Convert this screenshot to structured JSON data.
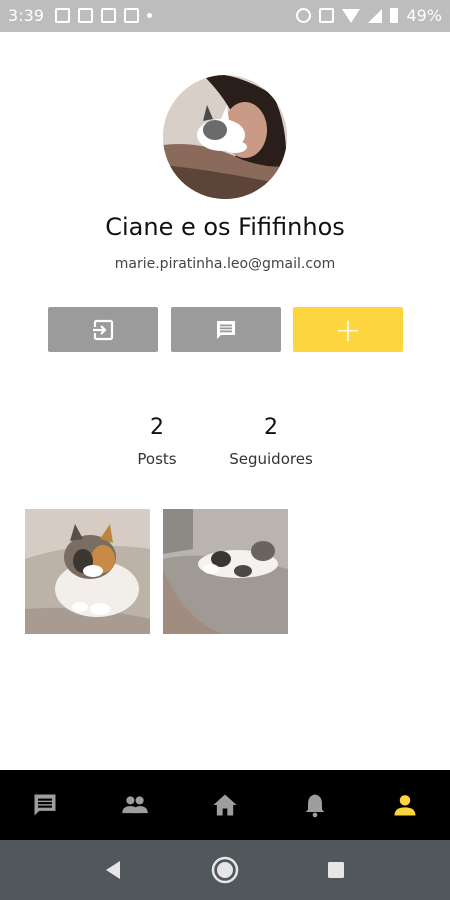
{
  "status_bar": {
    "time": "3:39",
    "battery": "49%"
  },
  "profile": {
    "name": "Ciane e os Fififinhos",
    "email": "marie.piratinha.leo@gmail.com"
  },
  "actions": [
    {
      "icon": "exit-to-app-icon"
    },
    {
      "icon": "message-icon"
    },
    {
      "icon": "plus-icon",
      "label": "+"
    }
  ],
  "stats": {
    "posts": {
      "value": "2",
      "label": "Posts"
    },
    "followers": {
      "value": "2",
      "label": "Seguidores"
    }
  },
  "bottom_nav": {
    "items": [
      {
        "icon": "chat-icon"
      },
      {
        "icon": "people-icon"
      },
      {
        "icon": "home-icon"
      },
      {
        "icon": "bell-icon"
      },
      {
        "icon": "person-icon",
        "active": true
      }
    ],
    "active_color": "#fcd53f",
    "inactive_color": "#9e9e9e"
  },
  "colors": {
    "accent": "#fcd53f",
    "button_grey": "#9b9b9b"
  }
}
